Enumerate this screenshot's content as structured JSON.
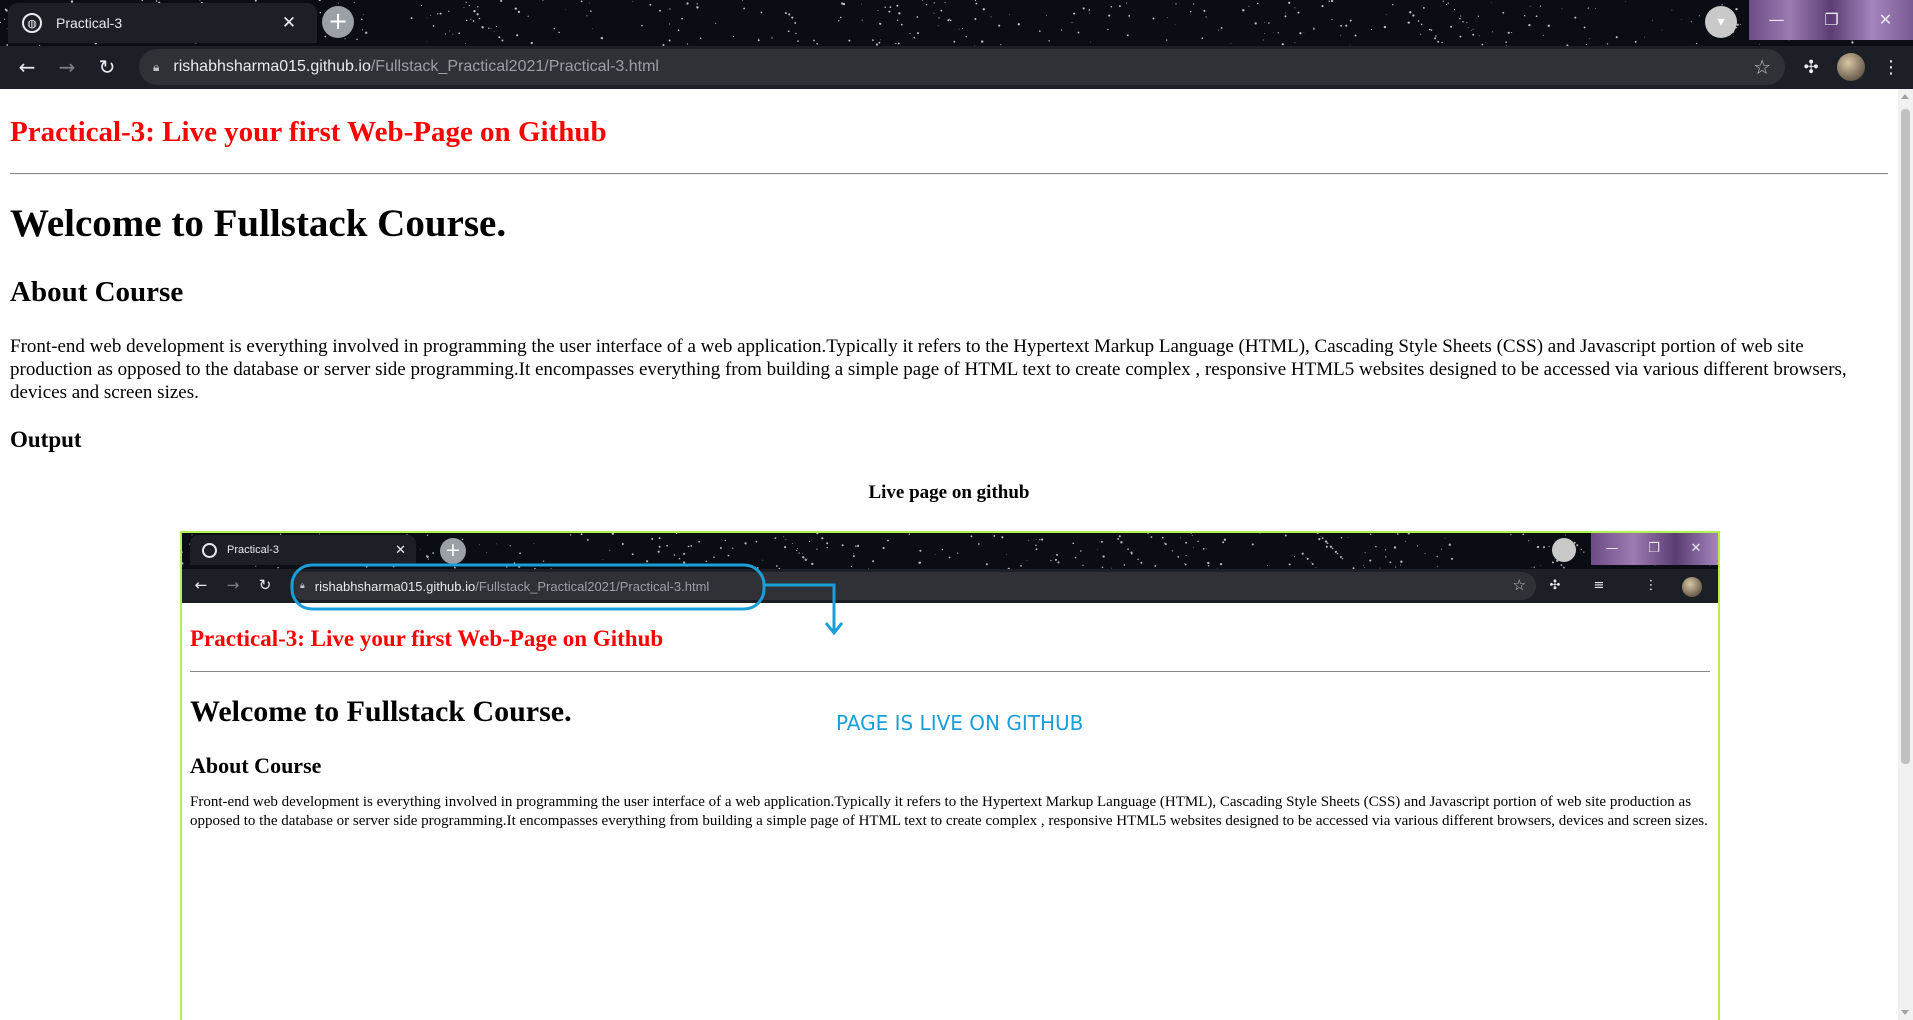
{
  "browser": {
    "tab_title": "Practical-3",
    "tab_close": "✕",
    "new_tab": "+",
    "url_host": "rishabhsharma015.github.io",
    "url_path": "/Fullstack_Practical2021/Practical-3.html",
    "icons": {
      "back": "arrow-left-icon",
      "forward": "arrow-right-icon",
      "reload": "reload-icon",
      "lock": "lock-icon",
      "bookmark": "star-icon",
      "extensions": "puzzle-icon",
      "menu": "kebab-menu-icon",
      "profile": "avatar-icon"
    },
    "window_controls": {
      "minimize": "—",
      "maximize": "❐",
      "close": "✕"
    }
  },
  "page": {
    "title": "Practical-3: Live your first Web-Page on Github",
    "heading": "Welcome to Fullstack Course.",
    "subheading": "About Course",
    "paragraph": "Front-end web development is everything involved in programming the user interface of a web application.Typically it refers to the Hypertext Markup Language (HTML), Cascading Style Sheets (CSS) and Javascript portion of web site production as opposed to the database or server side programming.It encompasses everything from building a simple page of HTML text to create complex , responsive HTML5 websites designed to be accessed via various different browsers, devices and screen sizes.",
    "output_heading": "Output",
    "figure_caption": "Live page on github"
  },
  "screenshot": {
    "tab_title": "Practical-3",
    "url_host": "rishabhsharma015.github.io",
    "url_path": "/Fullstack_Practical2021/Practical-3.html",
    "annotation": "PAGE IS LIVE ON GITHUB",
    "title": "Practical-3: Live your first Web-Page on Github",
    "heading": "Welcome to Fullstack Course.",
    "subheading": "About Course",
    "paragraph": "Front-end web development is everything involved in programming the user interface of a web application.Typically it refers to the Hypertext Markup Language (HTML), Cascading Style Sheets (CSS) and Javascript portion of web site production as opposed to the database or server side programming.It encompasses everything from building a simple page of HTML text to create complex , responsive HTML5 websites designed to be accessed via various different browsers, devices and screen sizes."
  },
  "colors": {
    "title_red": "#ff0000",
    "annotation_blue": "#1a9fd8",
    "screenshot_border": "#b2f24a",
    "chrome_dark": "#1d1f26"
  }
}
